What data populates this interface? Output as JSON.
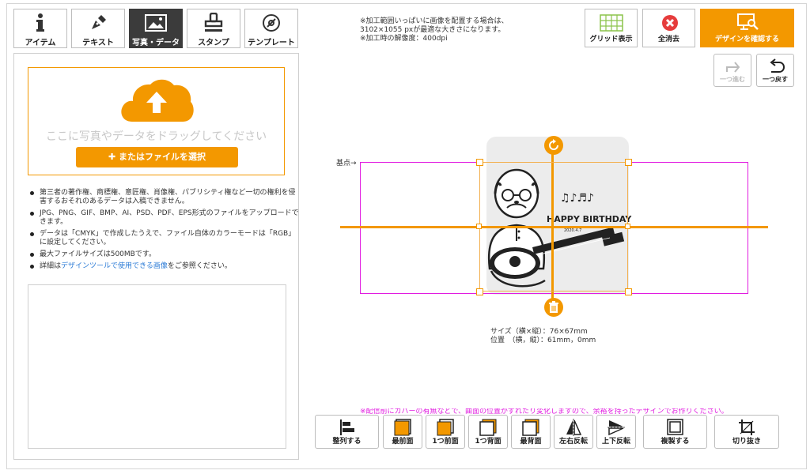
{
  "tabs": [
    {
      "label": "アイテム",
      "icon": "info-icon"
    },
    {
      "label": "テキスト",
      "icon": "pen-icon"
    },
    {
      "label": "写真・データ",
      "icon": "image-icon",
      "active": true
    },
    {
      "label": "スタンプ",
      "icon": "stamp-icon"
    },
    {
      "label": "テンプレート",
      "icon": "template-icon"
    }
  ],
  "upload": {
    "hint": "ここに写真やデータをドラッグしてください",
    "button": "またはファイルを選択"
  },
  "notes": [
    "第三者の著作権、商標権、意匠権、肖像権、パブリシティ権など一切の権利を侵害するおそれのあるデータは入稿できません。",
    "JPG、PNG、GIF、BMP、AI、PSD、PDF、EPS形式のファイルをアップロードできます。",
    "データは「CMYK」で作成したうえで、ファイル自体のカラーモードは「RGB」に設定してください。",
    "最大ファイルサイズは500MBです。"
  ],
  "note_link": {
    "pre": "詳細は",
    "link": "デザインツールで使用できる画像",
    "post": "をご参照ください。"
  },
  "top_note": "※加工範囲いっぱいに画像を配置する場合は、\n3102×1055 pxが最適な大きさになります。\n※加工時の解像度：400dpi",
  "toolbar": {
    "grid": "グリッド表示",
    "clear": "全消去",
    "confirm": "デザインを確認する",
    "redo": "一つ進む",
    "undo": "一つ戻す"
  },
  "canvas": {
    "basepoint": "基点→",
    "size_info": "サイズ（横×縦）：76×67mm\n位置　（横，縦）：61mm，0mm",
    "illustration_text": "HAPPY BIRTHDAY",
    "illustration_sub": "2020.4.7",
    "warning": "※配信前にカバーの有無などで、曲面の位置がずれたり変化しますので、余裕を持ったデザインでお作りください。"
  },
  "bottom_tools": [
    {
      "label": "整列する",
      "icon": "align-icon"
    },
    {
      "label": "最前面",
      "icon": "bring-front-icon"
    },
    {
      "label": "1つ前面",
      "icon": "bring-forward-icon"
    },
    {
      "label": "1つ背面",
      "icon": "send-backward-icon"
    },
    {
      "label": "最背面",
      "icon": "send-back-icon"
    },
    {
      "label": "左右反転",
      "icon": "flip-horizontal-icon"
    },
    {
      "label": "上下反転",
      "icon": "flip-vertical-icon"
    },
    {
      "label": "複製する",
      "icon": "duplicate-icon"
    },
    {
      "label": "切り抜き",
      "icon": "crop-icon"
    }
  ],
  "colors": {
    "accent": "#f39800",
    "guide": "#e11ce0",
    "link": "#2b7bd6",
    "delete": "#e63c3c",
    "grid": "#8bc34a"
  }
}
